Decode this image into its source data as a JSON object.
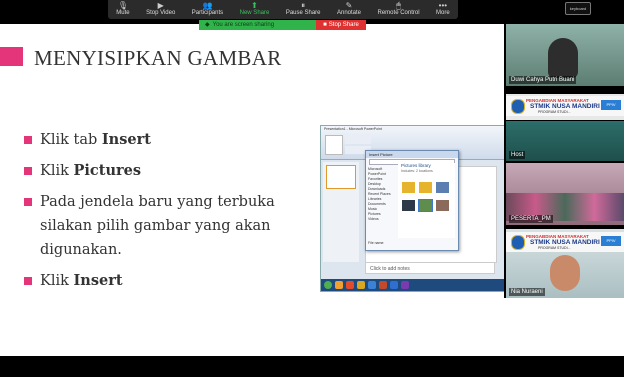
{
  "toolbar": {
    "items": [
      {
        "label": "Mute",
        "icon": "microphone-icon",
        "glyph": "🎙"
      },
      {
        "label": "Stop Video",
        "icon": "video-camera-icon",
        "glyph": "▶"
      },
      {
        "label": "Participants",
        "icon": "participants-icon",
        "glyph": "👥"
      },
      {
        "label": "New Share",
        "icon": "share-arrow-icon",
        "glyph": "⬆"
      },
      {
        "label": "Pause Share",
        "icon": "pause-icon",
        "glyph": "⏸"
      },
      {
        "label": "Annotate",
        "icon": "pencil-icon",
        "glyph": "✎"
      },
      {
        "label": "Remote Control",
        "icon": "remote-control-icon",
        "glyph": "🖱"
      },
      {
        "label": "More",
        "icon": "more-dots-icon",
        "glyph": "•••"
      }
    ],
    "accent": "#39c35a"
  },
  "share_bar": {
    "message": "You are screen sharing",
    "stop_label": "Stop Share"
  },
  "keyboard_button": "keyboard",
  "slide": {
    "title": "MENYISIPKAN GAMBAR",
    "accent": "#e5357a",
    "bullets": [
      {
        "prefix": "Klik tab ",
        "bold": "Insert",
        "suffix": ""
      },
      {
        "prefix": "Klik ",
        "bold": "Pictures",
        "suffix": ""
      },
      {
        "prefix": "Pada jendela baru yang terbuka silakan pilih gambar yang akan digunakan.",
        "bold": "",
        "suffix": ""
      },
      {
        "prefix": "Klik ",
        "bold": "Insert",
        "suffix": ""
      }
    ]
  },
  "embedded_screenshot": {
    "window_title": "Presentation1 - Microsoft PowerPoint",
    "dialog_title": "Insert Picture",
    "library_title": "Pictures library",
    "library_sub": "Includes: 2 locations",
    "sidebar_items": [
      "Microsoft PowerPoint",
      "Favorites",
      "Desktop",
      "Downloads",
      "Recent Places",
      "Libraries",
      "Documents",
      "Music",
      "Pictures",
      "Videos"
    ],
    "file_name_label": "File name:",
    "notes_placeholder": "Click to add notes"
  },
  "participants": [
    {
      "name": "Duwi Cahya Putri Buani"
    },
    {
      "name": ""
    },
    {
      "name": "Host"
    },
    {
      "name": "PESERTA_PM"
    },
    {
      "name": "Nia Nuraeni"
    }
  ],
  "banner": {
    "line1": "PENGABDIAN MASYARAKAT",
    "line2": "STMIK NUSA MANDIRI",
    "line3": "PROGRAM STUDI...",
    "badge": "PPIV"
  },
  "slide_nav": [
    {
      "icon": "previous-arrow-icon",
      "glyph": "⬅"
    },
    {
      "icon": "pen-icon",
      "glyph": "✎"
    },
    {
      "icon": "menu-icon",
      "glyph": "▤"
    },
    {
      "icon": "next-arrow-icon",
      "glyph": "➡"
    }
  ]
}
